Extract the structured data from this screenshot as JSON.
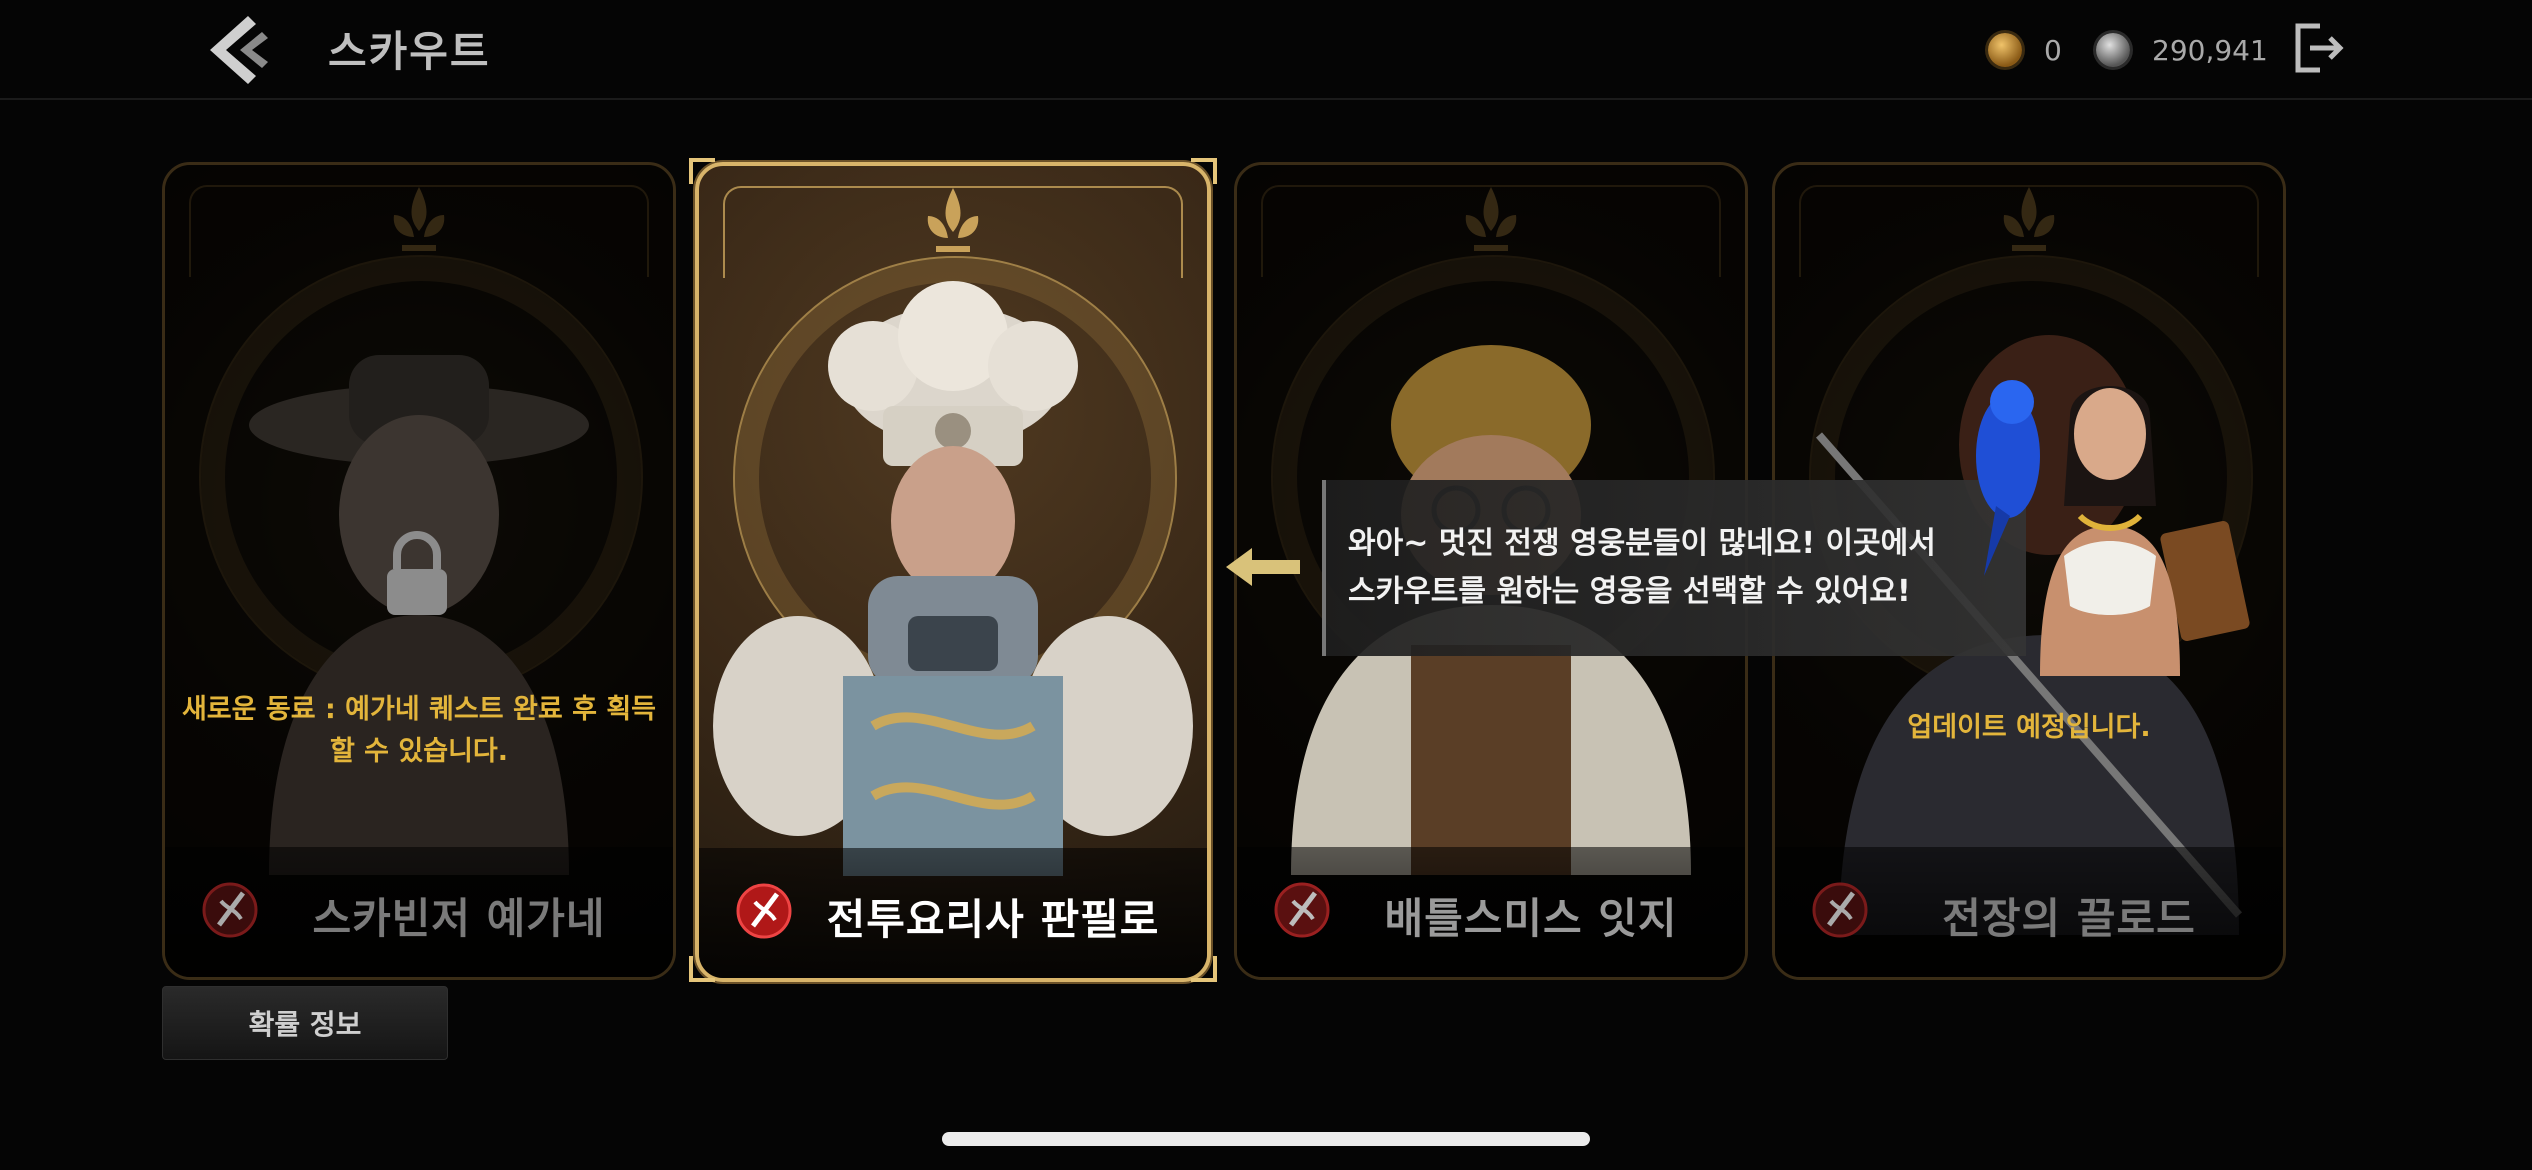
{
  "header": {
    "title": "스카우트",
    "currencies": [
      {
        "icon": "gold-coin-icon",
        "value": "0"
      },
      {
        "icon": "silver-coin-icon",
        "value": "290,941"
      }
    ]
  },
  "cards": [
    {
      "name": "스카빈저 예가네",
      "note": "새로운 동료 : 예가네 퀘스트 완료 후 획득 할 수 있습니다.",
      "state": "locked"
    },
    {
      "name": "전투요리사 판필로",
      "note": "",
      "state": "selected"
    },
    {
      "name": "배틀스미스 잇지",
      "note": "",
      "state": "available"
    },
    {
      "name": "전장의 끌로드",
      "note": "업데이트 예정입니다.",
      "state": "upcoming"
    }
  ],
  "probability_button": "확률 정보",
  "dialog": {
    "line1": "와아~ 멋진 전쟁 영웅분들이 많네요! 이곳에서",
    "line2": "스카우트를 원하는 영웅을 선택할 수 있어요!"
  },
  "colors": {
    "accent_gold": "#d8b46a",
    "note_yellow": "#e3b53b"
  }
}
